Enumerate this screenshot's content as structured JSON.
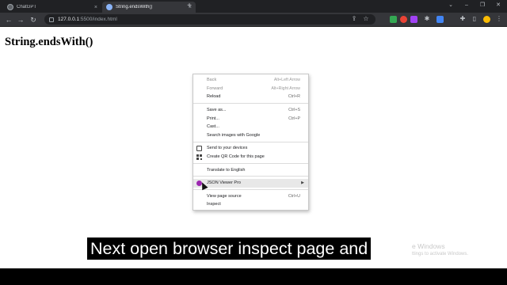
{
  "browser": {
    "tabs": [
      {
        "title": "ChatGPT",
        "active": false
      },
      {
        "title": "String.endsWith()",
        "active": true
      }
    ],
    "new_tab_glyph": "+",
    "tab_close_glyph": "×",
    "window_controls": {
      "chevron": "⌄",
      "minimize": "–",
      "restore": "❐",
      "close": "✕"
    },
    "nav": {
      "back": "←",
      "forward": "→",
      "reload": "↻"
    },
    "address": {
      "host": "127.0.0.1",
      "path": ":5500/index.html"
    },
    "toolbar_icons": [
      "share-icon",
      "star-icon",
      "extension-icon-green",
      "extension-icon-red",
      "extension-icon-purple",
      "extension-icon-gear",
      "extension-icon-blue",
      "puzzle-icon",
      "sidebar-icon",
      "profile-avatar",
      "menu-kebab-icon"
    ],
    "colors": {
      "tabstrip": "#202124",
      "toolbar": "#35363a",
      "accent": "#8ab4f8"
    }
  },
  "page": {
    "title": "String.endsWith()"
  },
  "context_menu": {
    "groups": [
      [
        {
          "label": "Back",
          "shortcut": "Alt+Left Arrow",
          "disabled": true
        },
        {
          "label": "Forward",
          "shortcut": "Alt+Right Arrow",
          "disabled": true
        },
        {
          "label": "Reload",
          "shortcut": "Ctrl+R",
          "disabled": false
        }
      ],
      [
        {
          "label": "Save as...",
          "shortcut": "Ctrl+S",
          "disabled": false
        },
        {
          "label": "Print...",
          "shortcut": "Ctrl+P",
          "disabled": false
        },
        {
          "label": "Cast...",
          "shortcut": "",
          "disabled": false
        },
        {
          "label": "Search images with Google",
          "shortcut": "",
          "disabled": false
        }
      ],
      [
        {
          "label": "Send to your devices",
          "shortcut": "",
          "icon": "devices-icon",
          "disabled": false
        },
        {
          "label": "Create QR Code for this page",
          "shortcut": "",
          "icon": "qr-code-icon",
          "disabled": false
        }
      ],
      [
        {
          "label": "Translate to English",
          "shortcut": "",
          "disabled": false
        }
      ],
      [
        {
          "label": "JSON Viewer Pro",
          "shortcut": "",
          "icon": "json-viewer-icon",
          "submenu": true,
          "highlighted": true,
          "disabled": false
        }
      ],
      [
        {
          "label": "View page source",
          "shortcut": "Ctrl+U",
          "disabled": false
        },
        {
          "label": "Inspect",
          "shortcut": "",
          "disabled": false
        }
      ]
    ],
    "submenu_glyph": "▶"
  },
  "watermark": {
    "title": "e Windows",
    "subtitle": "ttings to activate Windows."
  },
  "caption": {
    "text": "Next open browser inspect page and"
  }
}
